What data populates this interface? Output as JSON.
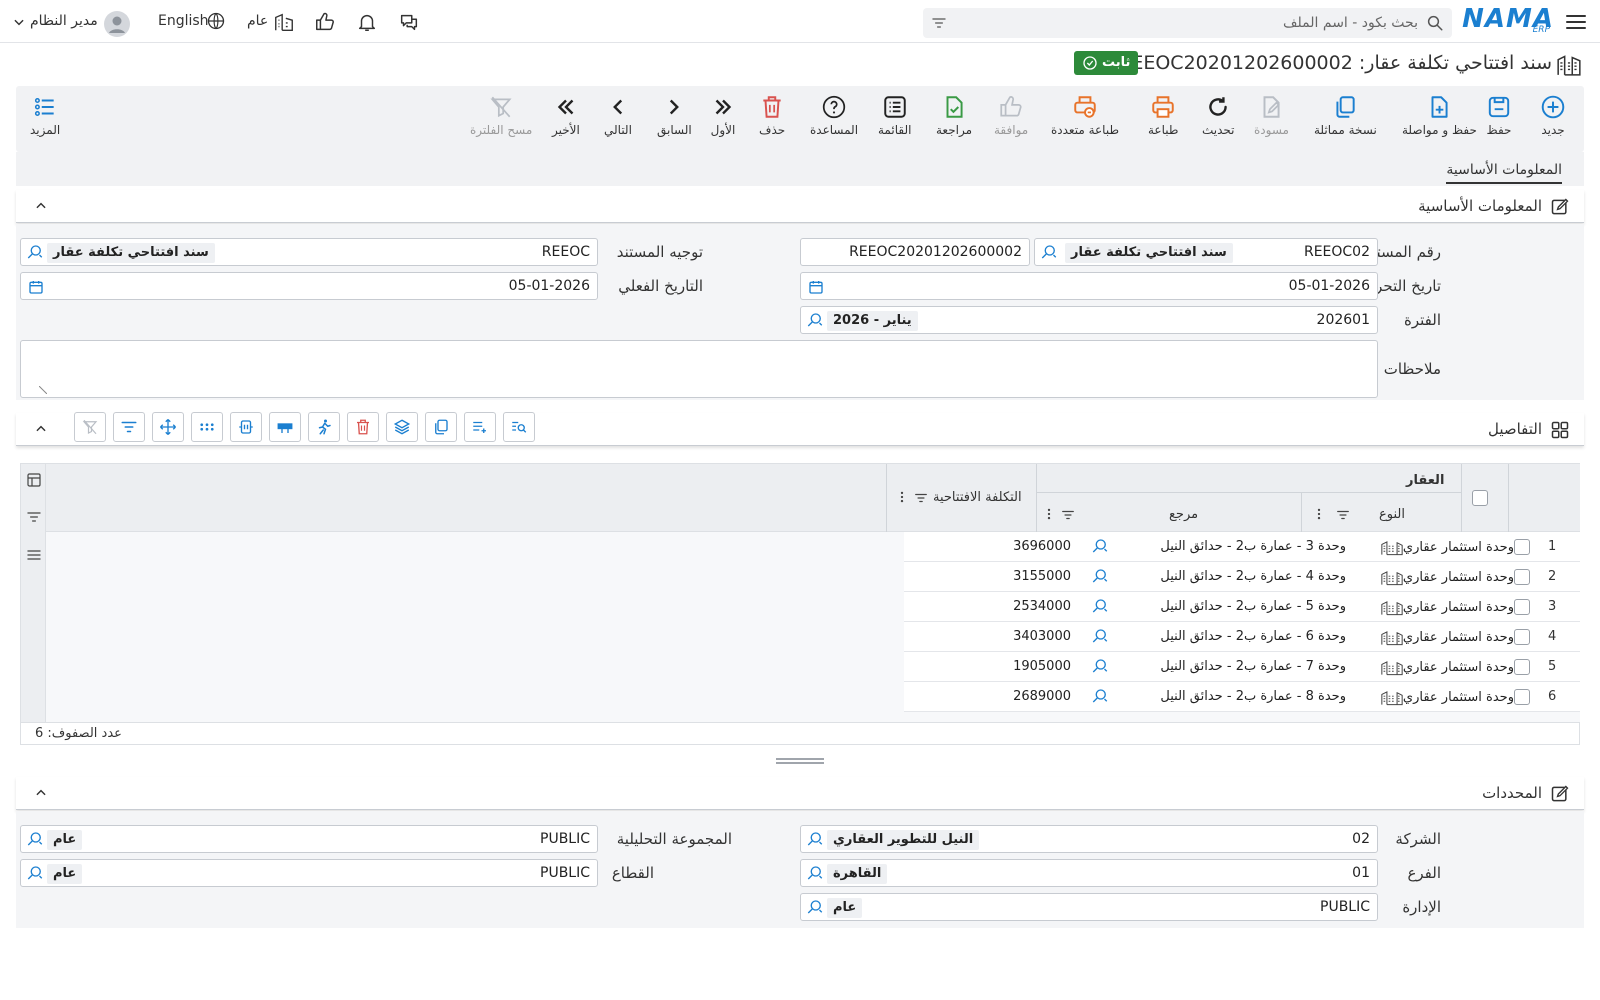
{
  "topbar": {
    "logo_text": "NAMA",
    "logo_sub": "ERP",
    "search_placeholder": "بحث بكود - اسم الملف",
    "language": "English",
    "company_scope": "عام",
    "user_name": "مدير النظام"
  },
  "document": {
    "title": "سند افتتاحي تكلفة عقار: REEOC2020120260000",
    "title_suffix": "2",
    "status": "ثابت"
  },
  "toolbar": {
    "buttons": [
      {
        "label": "جديد",
        "icon": "plus-circle-icon"
      },
      {
        "label": "حفظ",
        "icon": "save-icon"
      },
      {
        "label": "حفظ و مواصلة",
        "icon": "file-plus-icon"
      },
      {
        "label": "نسخة مماثلة",
        "icon": "copy-icon"
      },
      {
        "label": "مسودة",
        "icon": "draft-icon"
      },
      {
        "label": "تحديث",
        "icon": "refresh-icon"
      },
      {
        "label": "طباعة",
        "icon": "print-icon"
      },
      {
        "label": "طباعة متعددة",
        "icon": "multi-print-icon"
      },
      {
        "label": "موافقة",
        "icon": "thumbs-up-icon"
      },
      {
        "label": "مراجعة",
        "icon": "review-icon"
      },
      {
        "label": "القائمة",
        "icon": "list-icon"
      },
      {
        "label": "المساعدة",
        "icon": "help-icon"
      },
      {
        "label": "حذف",
        "icon": "trash-icon"
      },
      {
        "label": "الأول",
        "icon": "first-icon"
      },
      {
        "label": "السابق",
        "icon": "prev-icon"
      },
      {
        "label": "التالي",
        "icon": "next-icon"
      },
      {
        "label": "الأخير",
        "icon": "last-icon"
      },
      {
        "label": "مسح الفلترة",
        "icon": "clear-filter-icon"
      },
      {
        "label": "المزيد",
        "icon": "more-icon"
      }
    ]
  },
  "tabs": {
    "basic": "المعلومات الأساسية"
  },
  "basic_section": {
    "title": "المعلومات الأساسية",
    "labels": {
      "doc_number": "رقم المستند",
      "doc_direction": "توجيه المستند",
      "edit_date": "تاريخ التحرير",
      "actual_date": "التاريخ الفعلي",
      "period": "الفترة",
      "notes": "ملاحظات"
    },
    "values": {
      "doc_term_code": "REEOC02",
      "doc_term_desc": "سند افتتاحي تكلفة عقار",
      "doc_code": "REEOC20201202600002",
      "direction_code": "REEOC",
      "direction_desc": "سند افتتاحي تكلفة عقار",
      "edit_date": "05-01-2026",
      "actual_date": "05-01-2026",
      "period_code": "202601",
      "period_desc": "2026 - يناير",
      "notes": ""
    }
  },
  "details_section": {
    "title": "التفاصيل",
    "grid": {
      "group_header": "العقار",
      "col_type": "النوع",
      "col_ref": "مرجع",
      "col_cost": "التكلفة الافتتاحية",
      "rows": [
        {
          "n": "1",
          "type": "وحدة استثمار عقاري",
          "ref": "وحدة 3 - عمارة ب2 - حدائق النيل",
          "cost": "3696000"
        },
        {
          "n": "2",
          "type": "وحدة استثمار عقاري",
          "ref": "وحدة 4 - عمارة ب2 - حدائق النيل",
          "cost": "3155000"
        },
        {
          "n": "3",
          "type": "وحدة استثمار عقاري",
          "ref": "وحدة 5 - عمارة ب2 - حدائق النيل",
          "cost": "2534000"
        },
        {
          "n": "4",
          "type": "وحدة استثمار عقاري",
          "ref": "وحدة 6 - عمارة ب2 - حدائق النيل",
          "cost": "3403000"
        },
        {
          "n": "5",
          "type": "وحدة استثمار عقاري",
          "ref": "وحدة 7 - عمارة ب2 - حدائق النيل",
          "cost": "1905000"
        },
        {
          "n": "6",
          "type": "وحدة استثمار عقاري",
          "ref": "وحدة 8 - عمارة ب2 - حدائق النيل",
          "cost": "2689000"
        }
      ],
      "row_count_label": "عدد الصفوف: 6"
    }
  },
  "dimensions_section": {
    "title": "المحددات",
    "labels": {
      "company": "الشركة",
      "analysis_group": "المجموعة التحليلية",
      "branch": "الفرع",
      "sector": "القطاع",
      "department": "الإدارة"
    },
    "values": {
      "company_code": "02",
      "company_desc": "النيل للتطوير العقاري",
      "analysis_code": "PUBLIC",
      "analysis_desc": "عام",
      "branch_code": "01",
      "branch_desc": "القاهرة",
      "sector_code": "PUBLIC",
      "sector_desc": "عام",
      "department_code": "PUBLIC",
      "department_desc": "عام"
    }
  },
  "colors": {
    "accent": "#1b7fd0",
    "status_green": "#2d8a3a",
    "danger": "#d9534f",
    "print_orange": "#e8732a",
    "review_green": "#3a9a45"
  }
}
